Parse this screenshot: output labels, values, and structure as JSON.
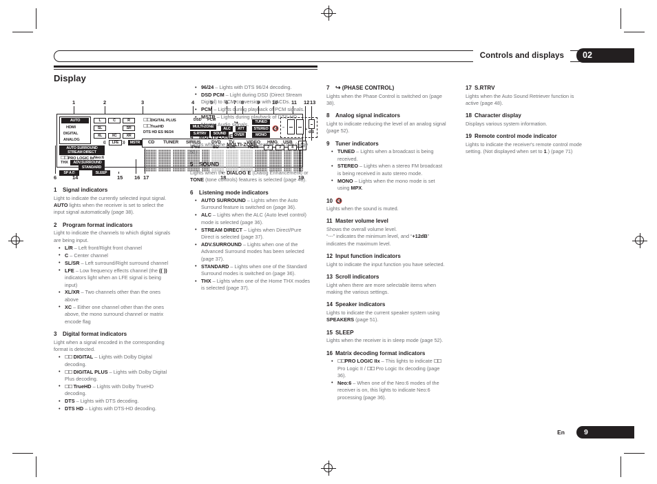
{
  "header": {
    "title": "Controls and displays",
    "chapter": "02"
  },
  "section": {
    "heading": "Display"
  },
  "figure": {
    "callouts_top": [
      "1",
      "2",
      "3",
      "4",
      "5",
      "6",
      "7",
      "8",
      "9",
      "10",
      "11",
      "12",
      "13"
    ],
    "callouts_bottom": [
      "6",
      "14",
      "15",
      "16",
      "17",
      "18",
      "19"
    ],
    "signal_block": {
      "auto": "AUTO",
      "hdmi": "HDMI",
      "digital": "DIGITAL",
      "analog": "ANALOG"
    },
    "channel_indicators": [
      "L",
      "C",
      "R",
      "SL",
      "SR",
      "XL",
      "XC",
      "XR",
      "LFE"
    ],
    "mstr": "MSTR",
    "digital_formats": {
      "digital_plus": "DIGITAL PLUS",
      "truehd": "TrueHD",
      "dts_line": "DTS HD ES 96/24",
      "dsd": "DSD",
      "pcm": "PCM",
      "multi_zone": "MULTI-ZONE",
      "srtrv": "S.RTRV",
      "sound": "SOUND"
    },
    "analog_tuner": {
      "alc": "ALC",
      "att": "ATT",
      "over": "OVER",
      "tuned": "TUNED",
      "stereo": "STEREO",
      "mono": "MONO"
    },
    "volume": {
      "db": "dB",
      "minus": "–",
      "plus": "+"
    },
    "listening_modes": {
      "auto_surround": "AUTO SURROUND",
      "stream_direct": "STREAM DIRECT",
      "pro_logic": "PRO LOGIC IIx",
      "neo6": "Neo:6",
      "thx": "THX",
      "adv_surround": "ADV.SURROUND",
      "standard": "STANDARD",
      "speakers": "SP A B",
      "sleep": "SLEEP"
    },
    "input_labels_row1": [
      "CD",
      "TUNER",
      "SIRIUS",
      "DVD",
      "TV",
      "VIDEO",
      "HMG",
      "USB"
    ],
    "input_labels_row2": [
      "iPod",
      "BD",
      "DVR",
      "HDMI"
    ],
    "remote_numbers": [
      "2",
      "3",
      "4"
    ]
  },
  "col1": {
    "items": [
      {
        "n": "1",
        "title": "Signal indicators",
        "para": "Light to indicate the currently selected input signal. AUTO lights when the receiver is set to select the input signal automatically (page 38)."
      },
      {
        "n": "2",
        "title": "Program format indicators",
        "para": "Light to indicate the channels to which digital signals are being input.",
        "bullets": [
          "L/R – Left front/Right front channel",
          "C – Center channel",
          "SL/SR – Left surround/Right surround channel",
          "LFE – Low frequency effects channel (the (( )) indicators light when an LFE signal is being input)",
          "XL/XR – Two channels other than the ones above",
          "XC – Either one channel other than the ones above, the mono surround channel or matrix encode flag"
        ]
      },
      {
        "n": "3",
        "title": "Digital format indicators",
        "para": "Light when a signal encoded in the corresponding format is detected.",
        "bullets": [
          "DIGITAL – Lights with Dolby Digital decoding.",
          "DIGITAL PLUS – Lights with Dolby Digital Plus decoding.",
          "TrueHD – Lights with Dolby TrueHD decoding.",
          "DTS – Lights with DTS decoding.",
          "DTS HD – Lights with DTS-HD decoding."
        ]
      }
    ]
  },
  "col2": {
    "top_bullets": [
      "96/24 – Lights with DTS 96/24 decoding.",
      "DSD PCM – Light during DSD (Direct Stream Digital) to PCM conversion with SACDs.",
      "PCM – Lights during playback of PCM signals.",
      "MSTR – Lights during playback of DTS-HD Master Audio signals."
    ],
    "items": [
      {
        "n": "4",
        "title": "MULTI-ZONE",
        "para": "Lights when the MULTI-ZONE feature is active (page 51)."
      },
      {
        "n": "5",
        "title": "SOUND",
        "para": "Lights when the DIALOG E (Dialog Enhancement) or TONE (tone controls) features is selected (page 48)."
      },
      {
        "n": "6",
        "title": "Listening mode indicators",
        "bullets": [
          "AUTO SURROUND – Lights when the Auto Surround feature is switched on (page 36).",
          "ALC – Lights when the ALC (Auto level control) mode is selected (page 36).",
          "STREAM DIRECT – Lights when Direct/Pure Direct is selected (page 37).",
          "ADV.SURROUND – Lights when one of the Advanced Surround modes has been selected (page 37).",
          "STANDARD – Lights when one of the Standard Surround modes is switched on (page 36).",
          "THX – Lights when one of the Home THX modes is selected (page 37)."
        ]
      }
    ]
  },
  "col3": {
    "items": [
      {
        "n": "7",
        "title": "(PHASE CONTROL)",
        "icon": "phase-control-icon",
        "para": "Lights when the Phase Control is switched on (page 38)."
      },
      {
        "n": "8",
        "title": "Analog signal indicators",
        "para": "Light to indicate reducing the level of an analog signal (page 52)."
      },
      {
        "n": "9",
        "title": "Tuner indicators",
        "bullets": [
          "TUNED – Lights when a broadcast is being received.",
          "STEREO – Lights when a stereo FM broadcast is being received in auto stereo mode.",
          "MONO – Lights when the mono mode is set using MPX."
        ]
      },
      {
        "n": "10",
        "title": "",
        "icon": "mute-icon",
        "para": "Lights when the sound is muted."
      },
      {
        "n": "11",
        "title": "Master volume level",
        "para": "Shows the overall volume level. “---” indicates the minimum level, and “+12dB” indicates the maximum level."
      },
      {
        "n": "12",
        "title": "Input function indicators",
        "para": "Light to indicate the input function you have selected."
      },
      {
        "n": "13",
        "title": "Scroll indicators",
        "para": "Light when there are more selectable items when making the various settings."
      },
      {
        "n": "14",
        "title": "Speaker indicators",
        "para": "Lights to indicate the current speaker system using SPEAKERS (page 51)."
      },
      {
        "n": "15",
        "title": "SLEEP",
        "para": "Lights when the receiver is in sleep mode (page 52)."
      },
      {
        "n": "16",
        "title": "Matrix decoding format indicators",
        "bullets": [
          "PRO LOGIC IIx – This lights to indicate Pro Logic II / Pro Logic IIx decoding (page 36).",
          "Neo:6 – When one of the Neo:6 modes of the receiver is on, this lights to indicate Neo:6 processing (page 36)."
        ]
      }
    ]
  },
  "col4": {
    "items": [
      {
        "n": "17",
        "title": "S.RTRV",
        "para": "Lights when the Auto Sound Retriever function is active (page 48)."
      },
      {
        "n": "18",
        "title": "Character display",
        "para": "Displays various system information."
      },
      {
        "n": "19",
        "title": "Remote control mode indicator",
        "para": "Lights to indicate the receiver's remote control mode setting. (Not displayed when set to 1.) (page 71)"
      }
    ]
  },
  "footer": {
    "lang": "En",
    "page": "9"
  }
}
